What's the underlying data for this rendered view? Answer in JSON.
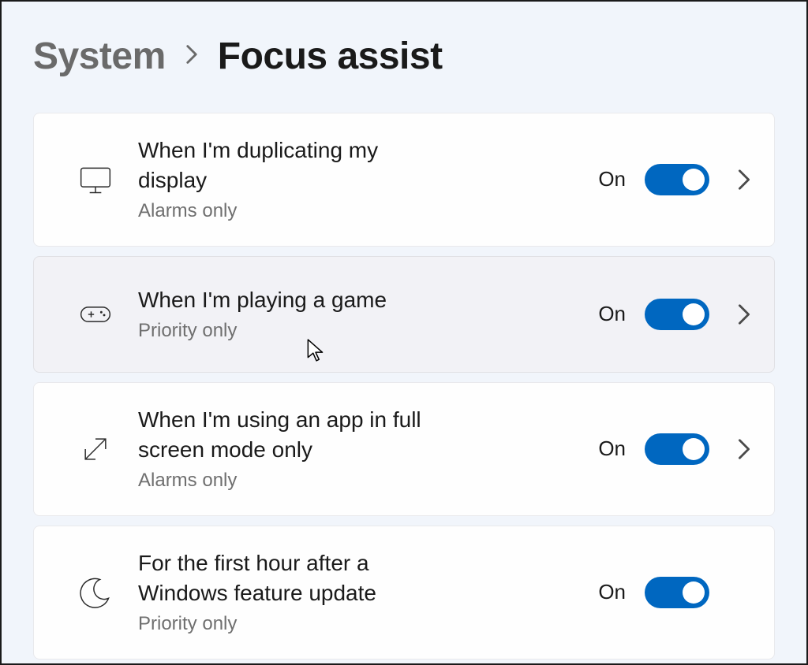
{
  "breadcrumb": {
    "parent": "System",
    "current": "Focus assist"
  },
  "settings": [
    {
      "title": "When I'm duplicating my display",
      "subtitle": "Alarms only",
      "state": "On",
      "expandable": true
    },
    {
      "title": "When I'm playing a game",
      "subtitle": "Priority only",
      "state": "On",
      "expandable": true
    },
    {
      "title": "When I'm using an app in full screen mode only",
      "subtitle": "Alarms only",
      "state": "On",
      "expandable": true
    },
    {
      "title": "For the first hour after a Windows feature update",
      "subtitle": "Priority only",
      "state": "On",
      "expandable": false
    }
  ],
  "colors": {
    "accent": "#0067c0"
  }
}
